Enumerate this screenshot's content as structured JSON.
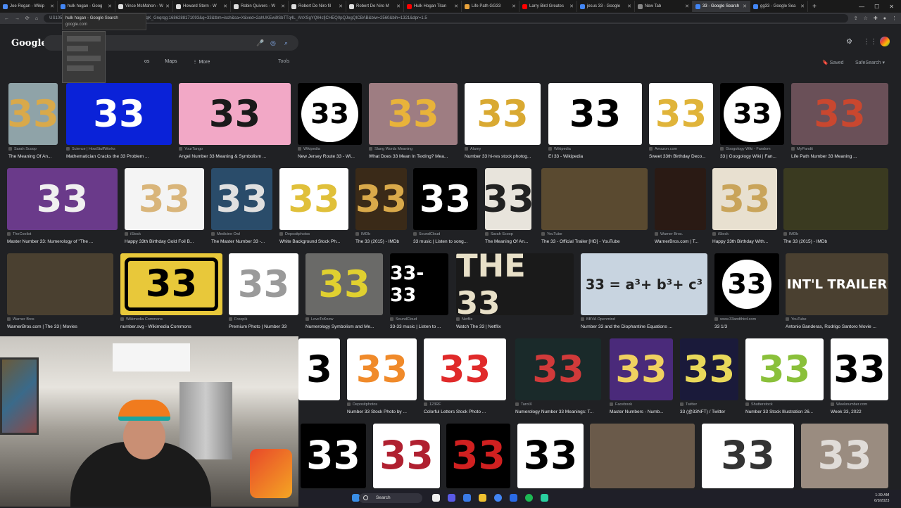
{
  "tabs": [
    {
      "label": "Joe Rogan - Wikip",
      "color": "#4c8bf5"
    },
    {
      "label": "hulk hogan - Goog",
      "color": "#4285f4"
    },
    {
      "label": "Vince McMahon - W",
      "color": "#dddddd"
    },
    {
      "label": "Howard Stern - W",
      "color": "#dddddd"
    },
    {
      "label": "Robin Quivers - W",
      "color": "#dddddd"
    },
    {
      "label": "Robert De Niro fil",
      "color": "#dddddd"
    },
    {
      "label": "Robert De Niro M",
      "color": "#dddddd"
    },
    {
      "label": "Hulk Hogan Titan",
      "color": "#ff0000"
    },
    {
      "label": "Life Path GG33",
      "color": "#e8a23a"
    },
    {
      "label": "Larry Bird Greates",
      "color": "#ff0000"
    },
    {
      "label": "jesus 33 - Google",
      "color": "#4285f4"
    },
    {
      "label": "New Tab",
      "color": "#888888"
    },
    {
      "label": "33 - Google Search",
      "color": "#4285f4"
    },
    {
      "label": "gg33 - Google Sea",
      "color": "#4285f4"
    }
  ],
  "address": {
    "url": "US1058&tbsrsf=APwXEdeAF9MNgQyNhCOaz9or8qK_Gnqrqg:1686288171093&q=33&tbm=isch&sa=X&ved=2ahUKEwi9SbTTq4L_AhXSgYQIHcfjCHEQ0pQJegQICBAB&biw=2560&bih=1321&dpr=1.5"
  },
  "tooltip": {
    "title": "hulk hogan - Google Search",
    "host": "google.com"
  },
  "google": {
    "logo": "Google",
    "filters": [
      "os",
      "Maps",
      "⋮ More"
    ],
    "tools": "Tools",
    "saved": "Saved",
    "safesearch": "SafeSearch"
  },
  "results": [
    {
      "src": "Sarah Scoop",
      "cap": "The Meaning Of An...",
      "text": "33",
      "bg": "#8fa3a8",
      "fg": "#d9a94a"
    },
    {
      "src": "Science | HowStuffWorks",
      "cap": "Mathematician Cracks the 33 Problem ...",
      "text": "33",
      "bg": "#0a22d8",
      "fg": "#ffffff"
    },
    {
      "src": "YourTango",
      "cap": "Angel Number 33 Meaning & Symbolism ...",
      "text": "33",
      "bg": "#f2a8c6",
      "fg": "#1a1a1a"
    },
    {
      "src": "Wikipedia",
      "cap": "New Jersey Route 33 - Wi...",
      "text": "33",
      "bg": "#000000",
      "fg": "#000000"
    },
    {
      "src": "Slang Words Meaning",
      "cap": "What Does 33 Mean In Texting? Mea...",
      "text": "33",
      "bg": "#9e7d82",
      "fg": "#e8b33a"
    },
    {
      "src": "Alamy",
      "cap": "Number 33 hi-res stock photog...",
      "text": "33",
      "bg": "#ffffff",
      "fg": "#d9a932"
    },
    {
      "src": "Wikipedia",
      "cap": "EI 33 - Wikipedia",
      "text": "33",
      "bg": "#ffffff",
      "fg": "#000000"
    },
    {
      "src": "Amazon.com",
      "cap": "Sweet 33th Birthday Deco...",
      "text": "33",
      "bg": "#ffffff",
      "fg": "#e0b43a"
    },
    {
      "src": "Googology Wiki - Fandom",
      "cap": "33 | Googology Wiki | Fan...",
      "text": "33",
      "bg": "#000000",
      "fg": "#000000"
    },
    {
      "src": "MyPandit",
      "cap": "Life Path Number 33 Meaning ...",
      "text": "33",
      "bg": "#6a5058",
      "fg": "#c9472f"
    },
    {
      "src": "TheCoolist",
      "cap": "Master Number 33: Numerology of \"The ...",
      "text": "33",
      "bg": "#6a3a8a",
      "fg": "#f0f0f0"
    },
    {
      "src": "iStock",
      "cap": "Happy 33th Birthday Gold Foil B...",
      "text": "33",
      "bg": "#f4f4f4",
      "fg": "#d9b57a"
    },
    {
      "src": "Medicine Owl",
      "cap": "The Master Number 33 -...",
      "text": "33",
      "bg": "#2a4c6a",
      "fg": "#e0e0e0"
    },
    {
      "src": "Depositphotos",
      "cap": "White Background Stock Ph...",
      "text": "33",
      "bg": "#ffffff",
      "fg": "#e0c03a"
    },
    {
      "src": "IMDb",
      "cap": "The 33 (2015) - IMDb",
      "text": "33",
      "bg": "#3a2a18",
      "fg": "#d9a94a"
    },
    {
      "src": "SoundCloud",
      "cap": "33 music | Listen to song...",
      "text": "33",
      "bg": "#000000",
      "fg": "#ffffff"
    },
    {
      "src": "Sarah Scoop",
      "cap": "The Meaning Of An...",
      "text": "33",
      "bg": "#e8e4dc",
      "fg": "#222222"
    },
    {
      "src": "YouTube",
      "cap": "The 33 - Official Trailer [HD] - YouTube",
      "text": "",
      "bg": "#5a4a30",
      "fg": "#ffffff"
    },
    {
      "src": "Warner Bros.",
      "cap": "WarnerBros.com | T...",
      "text": "",
      "bg": "#2a1a14",
      "fg": "#ffffff"
    },
    {
      "src": "iStock",
      "cap": "Happy 33th Birthday With...",
      "text": "33",
      "bg": "#e8e0d0",
      "fg": "#c9a45a"
    },
    {
      "src": "IMDb",
      "cap": "The 33 (2015) - IMDb",
      "text": "",
      "bg": "#3a3a20",
      "fg": "#ffffff"
    },
    {
      "src": "Warner Bros",
      "cap": "WarnerBros.com | The 33 | Movies",
      "text": "",
      "bg": "#4a4030",
      "fg": "#ffffff"
    },
    {
      "src": "Wikimedia Commons",
      "cap": "number.svg - Wikimedia Commons",
      "text": "33",
      "bg": "#e8c83a",
      "fg": "#000000"
    },
    {
      "src": "Freepik",
      "cap": "Premium Photo | Number 33",
      "text": "33",
      "bg": "#ffffff",
      "fg": "#9a9a9a"
    },
    {
      "src": "LoveToKnow",
      "cap": "Numerology Symbolism and Me...",
      "text": "33",
      "bg": "#6a6a68",
      "fg": "#e0d030"
    },
    {
      "src": "SoundCloud",
      "cap": "33-33 music | Listen to ...",
      "text": "33-33",
      "bg": "#000000",
      "fg": "#ffffff"
    },
    {
      "src": "Netflix",
      "cap": "Watch The 33 | Netflix",
      "text": "THE 33",
      "bg": "#1a1a1a",
      "fg": "#e8e0c8"
    },
    {
      "src": "BBVA Openmind",
      "cap": "Number 33 and the Diophantine Equations ...",
      "text": "33 = a³+ b³+ c³",
      "bg": "#c8d4e0",
      "fg": "#222222"
    },
    {
      "src": "www.33andthird.com",
      "cap": "33 1/3",
      "text": "33",
      "bg": "#000000",
      "fg": "#ffffff"
    },
    {
      "src": "YouTube",
      "cap": "Antonio Banderas, Rodrigo Santoro Movie ...",
      "text": "INT'L TRAILER",
      "bg": "#4a4030",
      "fg": "#ffffff"
    },
    {
      "src": "",
      "cap": "",
      "text": "3",
      "bg": "#ffffff",
      "fg": "#000000"
    },
    {
      "src": "Depositphotos",
      "cap": "Number 33 Stock Photo by ...",
      "text": "33",
      "bg": "#ffffff",
      "fg": "#f08a2a"
    },
    {
      "src": "123RF",
      "cap": "Colorful Letters Stock Photo ...",
      "text": "33",
      "bg": "#ffffff",
      "fg": "#e02a2a"
    },
    {
      "src": "TarotX",
      "cap": "Numerology Number 33 Meanings: T...",
      "text": "33",
      "bg": "#1a2a2a",
      "fg": "#d03a3a"
    },
    {
      "src": "Facebook",
      "cap": "Master Numbers - Numb...",
      "text": "33",
      "bg": "#4a2a7a",
      "fg": "#f0d060"
    },
    {
      "src": "Twitter",
      "cap": "33 (@33NFT) / Twitter",
      "text": "33",
      "bg": "#1a1a3a",
      "fg": "#e8d85a"
    },
    {
      "src": "Shutterstock",
      "cap": "Number 33 Stock Illustration 26...",
      "text": "33",
      "bg": "#ffffff",
      "fg": "#8ac03a"
    },
    {
      "src": "Weeknumber.com",
      "cap": "Week 33, 2022",
      "text": "33",
      "bg": "#ffffff",
      "fg": "#000000"
    },
    {
      "src": "",
      "cap": "",
      "text": "33",
      "bg": "#000000",
      "fg": "#ffffff"
    },
    {
      "src": "",
      "cap": "",
      "text": "33",
      "bg": "#ffffff",
      "fg": "#b02030"
    },
    {
      "src": "",
      "cap": "",
      "text": "33",
      "bg": "#000000",
      "fg": "#d02020"
    },
    {
      "src": "",
      "cap": "",
      "text": "33",
      "bg": "#ffffff",
      "fg": "#000000"
    },
    {
      "src": "",
      "cap": "",
      "text": "",
      "bg": "#6a5a4a",
      "fg": "#ffffff"
    },
    {
      "src": "",
      "cap": "",
      "text": "33",
      "bg": "#ffffff",
      "fg": "#333333"
    },
    {
      "src": "",
      "cap": "",
      "text": "33",
      "bg": "#9a8c80",
      "fg": "#e0dcd8"
    }
  ],
  "taskbar": {
    "search": "Search",
    "time": "1:39 AM",
    "date": "6/9/2023"
  }
}
